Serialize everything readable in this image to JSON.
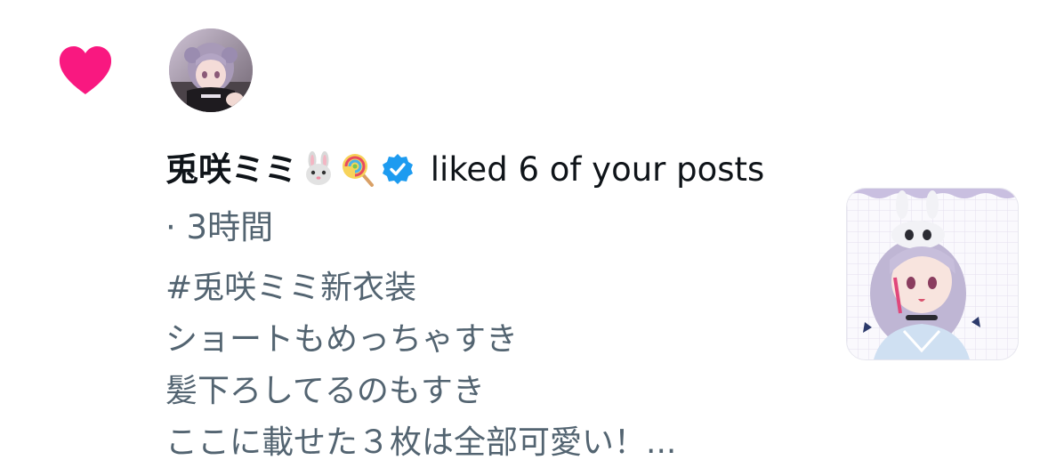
{
  "notification": {
    "type_icon": "heart-icon",
    "accent_color": "#f91880",
    "avatar": "user-avatar",
    "display_name": "兎咲ミミ",
    "name_emojis": [
      "rabbit-face-emoji",
      "lollipop-emoji"
    ],
    "verified_icon": "verified-badge-icon",
    "verified_color": "#1d9bf0",
    "action_text": " liked 6 of your posts",
    "separator": " · ",
    "time_ago": "3時間",
    "post_lines": [
      "#兎咲ミミ新衣装",
      "ショートもめっちゃすき",
      "髪下ろしてるのもすき",
      "ここに載せた３枚は全部可愛い！..."
    ],
    "thumbnail": "post-image-thumbnail"
  }
}
